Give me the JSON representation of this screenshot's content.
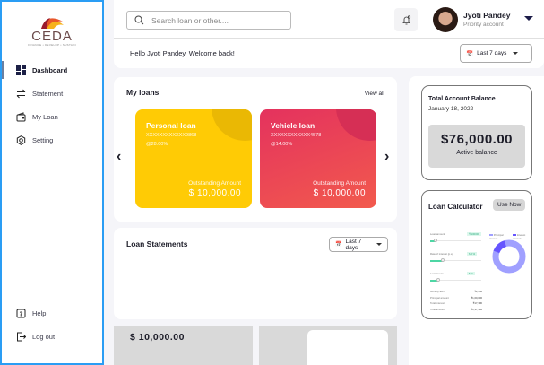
{
  "sidebar": {
    "logo": {
      "word": "CEDA",
      "tagline": "FINANCE • DEVELOP • SUSTAIN"
    },
    "items": [
      {
        "label": "Dashboard",
        "icon": "grid-icon"
      },
      {
        "label": "Statement",
        "icon": "transfer-icon"
      },
      {
        "label": "My Loan",
        "icon": "wallet-icon"
      },
      {
        "label": "Setting",
        "icon": "gear-icon"
      }
    ],
    "bottom": [
      {
        "label": "Help",
        "icon": "help-icon"
      },
      {
        "label": "Log out",
        "icon": "logout-icon"
      }
    ]
  },
  "header": {
    "search_placeholder": "Search loan or other....",
    "user_name": "Jyoti Pandey",
    "account_type": "Priority account",
    "welcome": "Hello Jyoti Pandey, Welcome back!",
    "range": "Last 7 days"
  },
  "my_loans": {
    "title": "My loans",
    "view_all": "View all",
    "loans": [
      {
        "title": "Personal loan",
        "number": "XXXXXXXXXXXX9868",
        "rate": "@28.00%",
        "outstanding_label": "Outstanding Amount",
        "amount": "$ 10,000.00",
        "color": "#ffcb05"
      },
      {
        "title": "Vehicle loan",
        "number": "XXXXXXXXXXXX4578",
        "rate": "@14.00%",
        "outstanding_label": "Outstanding Amount",
        "amount": "$ 10,000.00",
        "color": "#e8395b"
      }
    ]
  },
  "statements": {
    "title": "Loan Statements",
    "range": "Last 7 days"
  },
  "bottom_amount": "$ 10,000.00",
  "balance": {
    "title": "Total Account Balance",
    "date": "January 18, 2022",
    "amount": "$76,000.00",
    "label": "Active balance"
  },
  "calculator": {
    "title": "Loan Calculator",
    "button": "Use Now",
    "inputs": [
      {
        "label": "Loan amount",
        "value": "₹ 100000",
        "fill": 0.1
      },
      {
        "label": "Rate of interest (p.a)",
        "value": "6.5 %",
        "fill": 0.25
      },
      {
        "label": "Loan tenure",
        "value": "5 Yr",
        "fill": 0.15
      }
    ],
    "legend": [
      "Principal amount",
      "Interest amount"
    ],
    "interest_share": 0.15,
    "results": [
      {
        "label": "Monthly EMI",
        "value": "₹1,956"
      },
      {
        "label": "Principal amount",
        "value": "₹1,00,000"
      },
      {
        "label": "Total interest",
        "value": "₹17,396"
      },
      {
        "label": "Total amount",
        "value": "₹1,17,396"
      }
    ]
  }
}
